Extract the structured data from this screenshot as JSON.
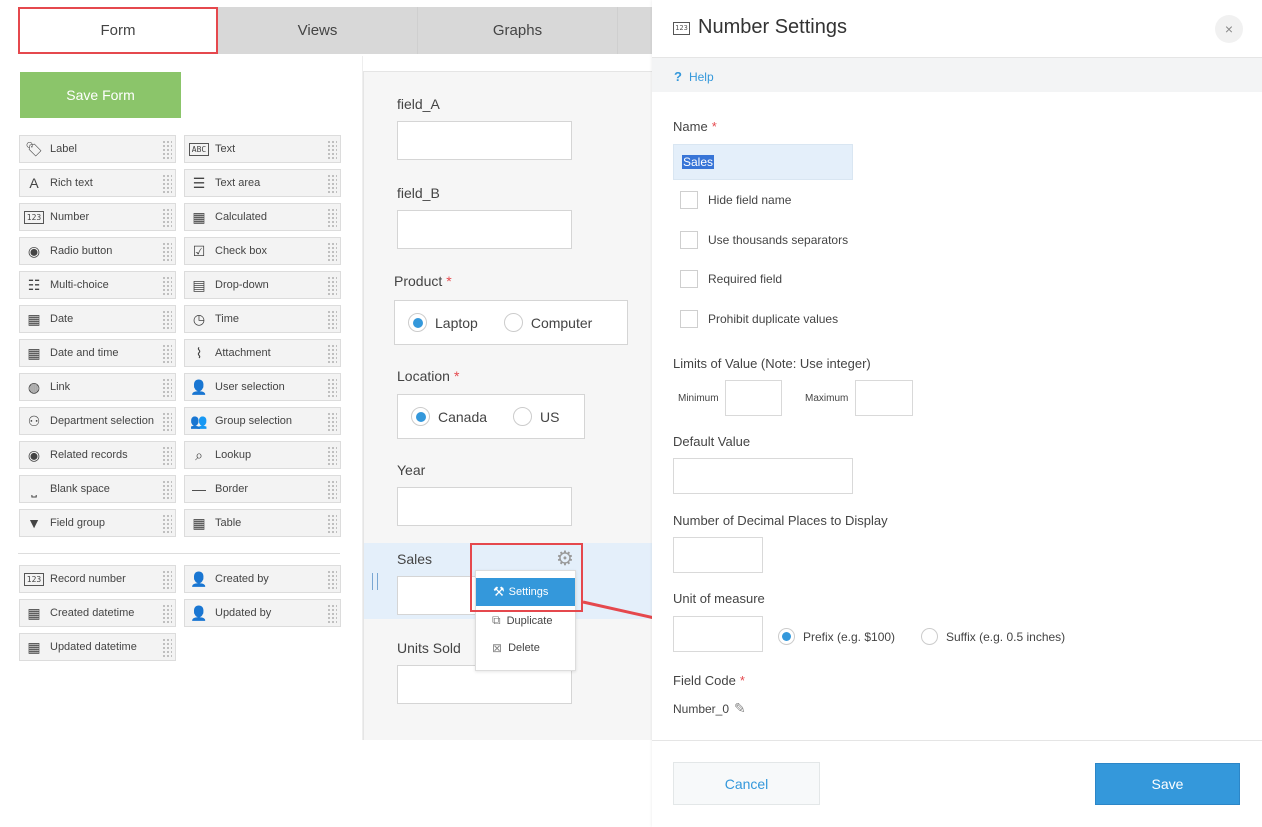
{
  "tabs": [
    "Form",
    "Views",
    "Graphs",
    ""
  ],
  "save_form": "Save Form",
  "palette": [
    {
      "label": "Label",
      "icon": "tag-icon",
      "glyph": "🏷"
    },
    {
      "label": "Text",
      "icon": "abc-text-icon",
      "glyph": "ABC"
    },
    {
      "label": "Rich text",
      "icon": "rich-text-icon",
      "glyph": "A"
    },
    {
      "label": "Text area",
      "icon": "text-area-icon",
      "glyph": "☰"
    },
    {
      "label": "Number",
      "icon": "number-icon",
      "glyph": "123"
    },
    {
      "label": "Calculated",
      "icon": "calculator-icon",
      "glyph": "▦"
    },
    {
      "label": "Radio button",
      "icon": "radio-icon",
      "glyph": "◉"
    },
    {
      "label": "Check box",
      "icon": "checkbox-icon",
      "glyph": "☑"
    },
    {
      "label": "Multi-choice",
      "icon": "multi-choice-icon",
      "glyph": "☷"
    },
    {
      "label": "Drop-down",
      "icon": "dropdown-icon",
      "glyph": "▤"
    },
    {
      "label": "Date",
      "icon": "calendar-icon",
      "glyph": "▦"
    },
    {
      "label": "Time",
      "icon": "clock-icon",
      "glyph": "◷"
    },
    {
      "label": "Date and time",
      "icon": "calendar-time-icon",
      "glyph": "▦"
    },
    {
      "label": "Attachment",
      "icon": "paperclip-icon",
      "glyph": "⌇"
    },
    {
      "label": "Link",
      "icon": "globe-icon",
      "glyph": "◍"
    },
    {
      "label": "User selection",
      "icon": "user-icon",
      "glyph": "👤"
    },
    {
      "label": "Department selection",
      "icon": "org-chart-icon",
      "glyph": "⚇"
    },
    {
      "label": "Group selection",
      "icon": "group-icon",
      "glyph": "👥"
    },
    {
      "label": "Related records",
      "icon": "eye-icon",
      "glyph": "◉"
    },
    {
      "label": "Lookup",
      "icon": "lookup-icon",
      "glyph": "⌕"
    },
    {
      "label": "Blank space",
      "icon": "blank-space-icon",
      "glyph": "⎵"
    },
    {
      "label": "Border",
      "icon": "border-icon",
      "glyph": "—"
    },
    {
      "label": "Field group",
      "icon": "field-group-icon",
      "glyph": "▼"
    },
    {
      "label": "Table",
      "icon": "table-icon",
      "glyph": "▦"
    }
  ],
  "palette_system": [
    {
      "label": "Record number",
      "icon": "record-number-icon",
      "glyph": "123"
    },
    {
      "label": "Created by",
      "icon": "user-icon",
      "glyph": "👤"
    },
    {
      "label": "Created datetime",
      "icon": "calendar-icon",
      "glyph": "▦"
    },
    {
      "label": "Updated by",
      "icon": "user-icon",
      "glyph": "👤"
    },
    {
      "label": "Updated datetime",
      "icon": "calendar-icon",
      "glyph": "▦"
    }
  ],
  "form": {
    "field_a": "field_A",
    "field_b": "field_B",
    "product": {
      "label": "Product",
      "options": [
        "Laptop",
        "Computer"
      ],
      "selected": 0
    },
    "location": {
      "label": "Location",
      "options": [
        "Canada",
        "US"
      ],
      "selected": 0
    },
    "year": "Year",
    "sales": "Sales",
    "units_sold": "Units Sold"
  },
  "context_menu": {
    "settings": "Settings",
    "duplicate": "Duplicate",
    "delete": "Delete"
  },
  "panel": {
    "title": "Number Settings",
    "title_icon": "123",
    "close": "×",
    "help": "Help",
    "name_label": "Name",
    "name_value": "Sales",
    "checkboxes": [
      "Hide field name",
      "Use thousands separators",
      "Required field",
      "Prohibit duplicate values"
    ],
    "limits_label": "Limits of Value (Note: Use integer)",
    "minimum": "Minimum",
    "maximum": "Maximum",
    "default_label": "Default Value",
    "decimal_label": "Number of Decimal Places to Display",
    "unit_label": "Unit of measure",
    "prefix": "Prefix (e.g. $100)",
    "suffix": "Suffix (e.g. 0.5 inches)",
    "unit_selected": "prefix",
    "field_code_label": "Field Code",
    "field_code_value": "Number_0",
    "cancel": "Cancel",
    "save": "Save"
  },
  "colors": {
    "accent": "#3498db",
    "save_form": "#8bc56a",
    "highlight": "#e5484d"
  }
}
